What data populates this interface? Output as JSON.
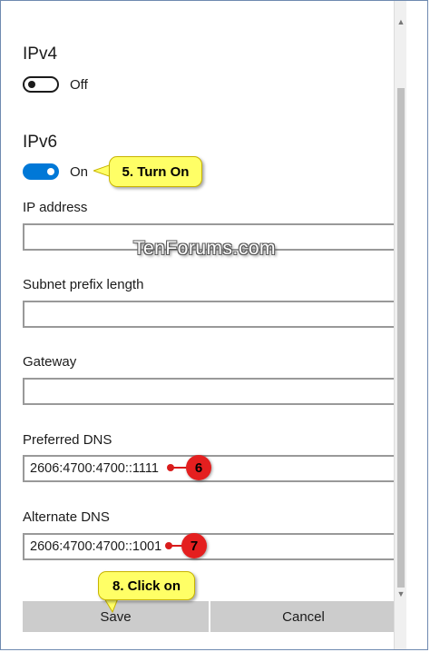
{
  "ipv4": {
    "title": "IPv4",
    "toggle_state": "Off"
  },
  "ipv6": {
    "title": "IPv6",
    "toggle_state": "On",
    "fields": {
      "ip_address": {
        "label": "IP address",
        "value": ""
      },
      "subnet_prefix_length": {
        "label": "Subnet prefix length",
        "value": ""
      },
      "gateway": {
        "label": "Gateway",
        "value": ""
      },
      "preferred_dns": {
        "label": "Preferred DNS",
        "value": "2606:4700:4700::1111"
      },
      "alternate_dns": {
        "label": "Alternate DNS",
        "value": "2606:4700:4700::1001"
      }
    }
  },
  "buttons": {
    "save": "Save",
    "cancel": "Cancel"
  },
  "annotations": {
    "step5": "5. Turn On",
    "step6": "6",
    "step7": "7",
    "step8": "8. Click on"
  },
  "watermark": "TenForums.com",
  "colors": {
    "accent": "#0078d7",
    "callout": "#ffff66",
    "step_badge": "#e41f1f",
    "button": "#cccccc"
  },
  "icons": {
    "scroll_up": "chevron-up-icon",
    "scroll_down": "chevron-down-icon"
  }
}
